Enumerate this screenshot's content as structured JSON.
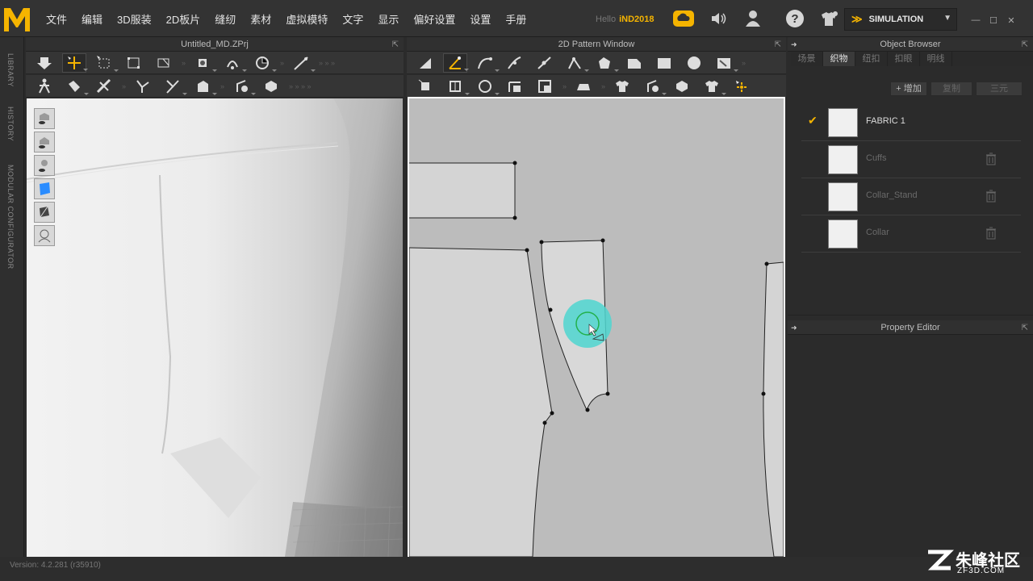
{
  "app": {
    "logo_letter": "M",
    "accent_color": "#f5b400"
  },
  "menu": {
    "items": [
      "文件",
      "编辑",
      "3D服装",
      "2D板片",
      "缝纫",
      "素材",
      "虚拟模特",
      "文字",
      "显示",
      "偏好设置",
      "设置",
      "手册"
    ]
  },
  "header": {
    "hello_label": "Hello",
    "user": "iND2018",
    "mode_label": "SIMULATION"
  },
  "left_strip": {
    "library": "LIBRARY",
    "history": "HISTORY",
    "modular": "MODULAR CONFIGURATOR"
  },
  "panels": {
    "view3d_title": "Untitled_MD.ZPrj",
    "view2d_title": "2D Pattern Window",
    "object_browser_title": "Object Browser",
    "property_editor_title": "Property Editor"
  },
  "object_browser": {
    "tabs": [
      "场景",
      "织物",
      "纽扣",
      "扣眼",
      "明线"
    ],
    "active_tab": "织物",
    "add_label": "+ 增加",
    "copy_label": "复制",
    "delete_label": "三元"
  },
  "fabrics": [
    {
      "name": "FABRIC 1",
      "selected": true
    },
    {
      "name": "Cuffs",
      "selected": false
    },
    {
      "name": "Collar_Stand",
      "selected": false
    },
    {
      "name": "Collar",
      "selected": false
    }
  ],
  "status": {
    "version": "Version: 4.2.281 (r35910)"
  },
  "watermark": {
    "site": "朱峰社区",
    "url": "ZF3D.COM"
  }
}
